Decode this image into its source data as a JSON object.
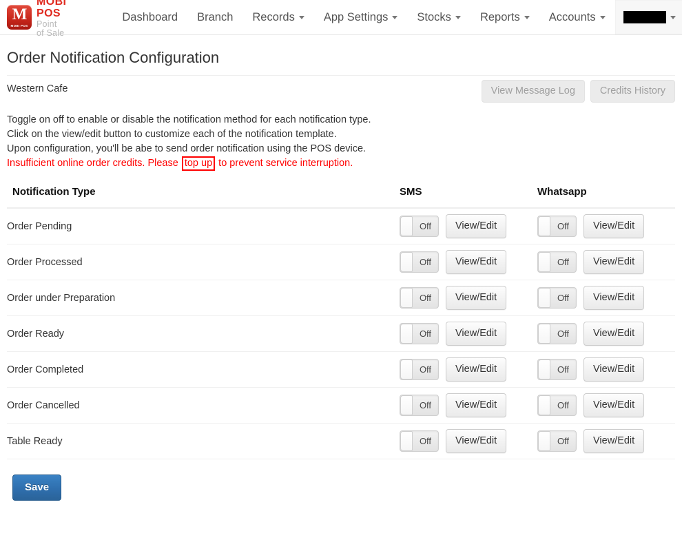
{
  "brand": {
    "logo_mark": "M",
    "logo_mark_sub": "MOBI POS",
    "title": "MOBI POS",
    "subtitle": "Point of Sale",
    "brand_color": "#e02b20"
  },
  "nav": {
    "items": [
      {
        "label": "Dashboard",
        "has_caret": false,
        "active": false
      },
      {
        "label": "Branch",
        "has_caret": false,
        "active": false
      },
      {
        "label": "Records",
        "has_caret": true,
        "active": false
      },
      {
        "label": "App Settings",
        "has_caret": true,
        "active": false
      },
      {
        "label": "Stocks",
        "has_caret": true,
        "active": false
      },
      {
        "label": "Reports",
        "has_caret": true,
        "active": false
      },
      {
        "label": "Accounts",
        "has_caret": true,
        "active": false
      },
      {
        "label": "",
        "has_caret": true,
        "active": true,
        "redacted": true
      }
    ]
  },
  "header": {
    "page_title": "Order Notification Configuration",
    "shop_name": "Western Cafe",
    "view_message_log_label": "View Message Log",
    "credits_history_label": "Credits History"
  },
  "instructions": {
    "line1": "Toggle on off to enable or disable the notification method for each notification type.",
    "line2": "Click on the view/edit button to customize each of the notification template.",
    "line3": "Upon configuration, you'll be abe to send order notification using the POS device.",
    "warning_prefix": "Insufficient online order credits. Please ",
    "warning_link": "top up",
    "warning_suffix": " to prevent service interruption.",
    "warning_color": "#ff0000"
  },
  "table": {
    "headers": {
      "type": "Notification Type",
      "sms": "SMS",
      "whatsapp": "Whatsapp"
    },
    "toggle_off_label": "Off",
    "view_edit_label": "View/Edit",
    "rows": [
      {
        "type": "Order Pending",
        "sms_toggle": "Off",
        "sms_button": "View/Edit",
        "wa_toggle": "Off",
        "wa_button": "View/Edit"
      },
      {
        "type": "Order Processed",
        "sms_toggle": "Off",
        "sms_button": "View/Edit",
        "wa_toggle": "Off",
        "wa_button": "View/Edit"
      },
      {
        "type": "Order under Preparation",
        "sms_toggle": "Off",
        "sms_button": "View/Edit",
        "wa_toggle": "Off",
        "wa_button": "View/Edit"
      },
      {
        "type": "Order Ready",
        "sms_toggle": "Off",
        "sms_button": "View/Edit",
        "wa_toggle": "Off",
        "wa_button": "View/Edit"
      },
      {
        "type": "Order Completed",
        "sms_toggle": "Off",
        "sms_button": "View/Edit",
        "wa_toggle": "Off",
        "wa_button": "View/Edit"
      },
      {
        "type": "Order Cancelled",
        "sms_toggle": "Off",
        "sms_button": "View/Edit",
        "wa_toggle": "Off",
        "wa_button": "View/Edit"
      },
      {
        "type": "Table Ready",
        "sms_toggle": "Off",
        "sms_button": "View/Edit",
        "wa_toggle": "Off",
        "wa_button": "View/Edit"
      }
    ]
  },
  "footer": {
    "save_label": "Save",
    "save_color": "#2f6fae"
  }
}
